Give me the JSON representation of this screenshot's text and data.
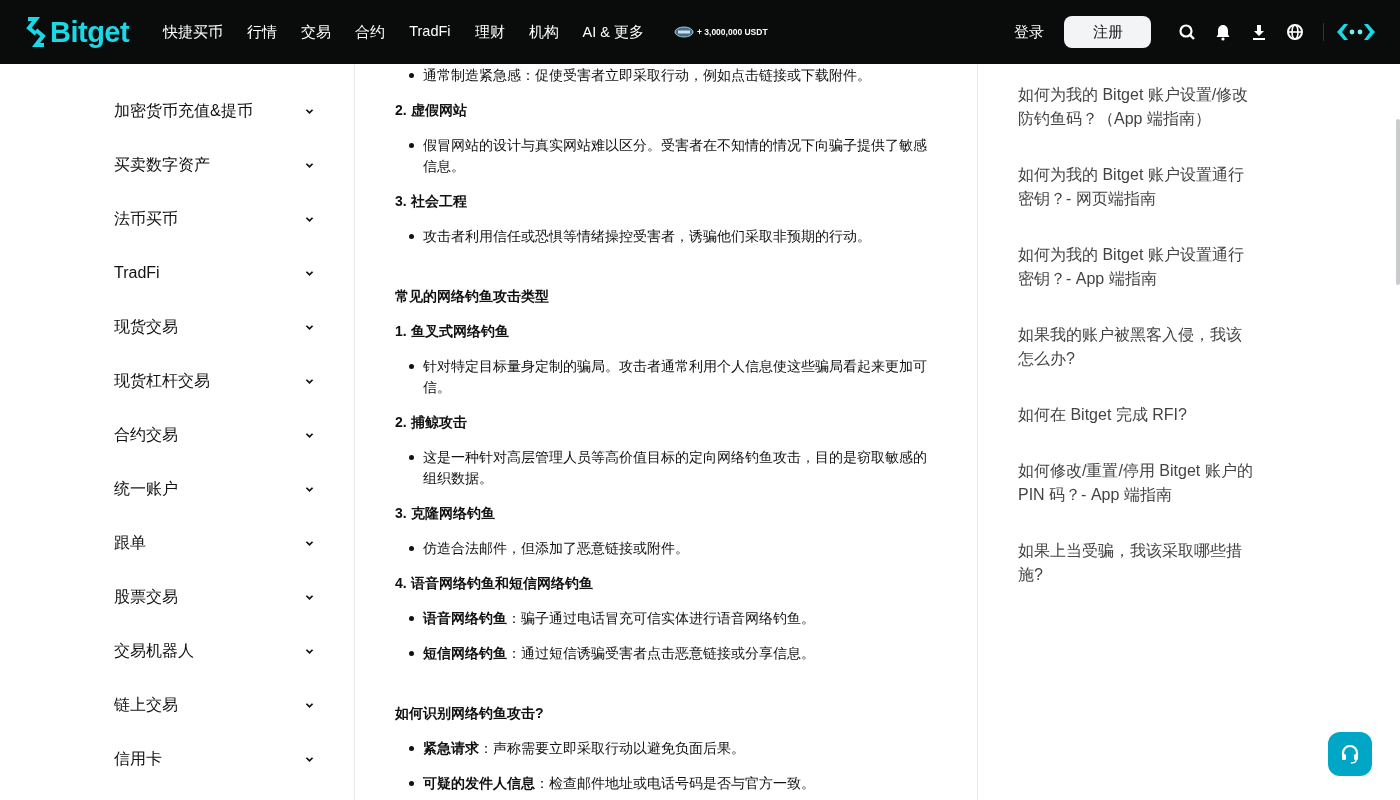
{
  "header": {
    "logo": "Bitget",
    "nav": [
      "快捷买币",
      "行情",
      "交易",
      "合约",
      "TradFi",
      "理财",
      "机构",
      "AI & 更多"
    ],
    "promo": "+ 3,000,000 USDT",
    "login": "登录",
    "signup": "注册"
  },
  "sidebar": {
    "items": [
      {
        "label": "加密货币充值&提币",
        "expanded": false
      },
      {
        "label": "买卖数字资产",
        "expanded": false
      },
      {
        "label": "法币买币",
        "expanded": false
      },
      {
        "label": "TradFi",
        "expanded": false
      },
      {
        "label": "现货交易",
        "expanded": false
      },
      {
        "label": "现货杠杆交易",
        "expanded": false
      },
      {
        "label": "合约交易",
        "expanded": false
      },
      {
        "label": "统一账户",
        "expanded": false
      },
      {
        "label": "跟单",
        "expanded": false
      },
      {
        "label": "股票交易",
        "expanded": false
      },
      {
        "label": "交易机器人",
        "expanded": false
      },
      {
        "label": "链上交易",
        "expanded": false
      },
      {
        "label": "信用卡",
        "expanded": false
      }
    ]
  },
  "article": {
    "blocks": [
      {
        "kind": "bullet",
        "text": "通常制造紧急感：促使受害者立即采取行动，例如点击链接或下载附件。"
      },
      {
        "kind": "subheading",
        "text": "2. 虚假网站"
      },
      {
        "kind": "bullet",
        "text": "假冒网站的设计与真实网站难以区分。受害者在不知情的情况下向骗子提供了敏感信息。"
      },
      {
        "kind": "subheading",
        "text": "3. 社会工程"
      },
      {
        "kind": "bullet",
        "text": "攻击者利用信任或恐惧等情绪操控受害者，诱骗他们采取非预期的行动。"
      },
      {
        "kind": "heading",
        "text": "常见的网络钓鱼攻击类型"
      },
      {
        "kind": "subheading",
        "text": "1. 鱼叉式网络钓鱼"
      },
      {
        "kind": "bullet",
        "text": "针对特定目标量身定制的骗局。攻击者通常利用个人信息使这些骗局看起来更加可信。"
      },
      {
        "kind": "subheading",
        "text": "2. 捕鲸攻击"
      },
      {
        "kind": "bullet",
        "text": "这是一种针对高层管理人员等高价值目标的定向网络钓鱼攻击，目的是窃取敏感的组织数据。"
      },
      {
        "kind": "subheading",
        "text": "3. 克隆网络钓鱼"
      },
      {
        "kind": "bullet",
        "text": "仿造合法邮件，但添加了恶意链接或附件。"
      },
      {
        "kind": "subheading",
        "text": "4. 语音网络钓鱼和短信网络钓鱼"
      },
      {
        "kind": "bullet",
        "text": "**语音网络钓鱼**：骗子通过电话冒充可信实体进行语音网络钓鱼。"
      },
      {
        "kind": "bullet",
        "text": "**短信网络钓鱼**：通过短信诱骗受害者点击恶意链接或分享信息。"
      },
      {
        "kind": "heading",
        "text": "如何识别网络钓鱼攻击?"
      },
      {
        "kind": "bullet",
        "text": "**紧急请求**：声称需要立即采取行动以避免负面后果。"
      },
      {
        "kind": "bullet",
        "text": "**可疑的发件人信息**：检查邮件地址或电话号码是否与官方一致。"
      }
    ]
  },
  "related": [
    "如何为我的 Bitget 账户设置/修改防钓鱼码？（App 端指南）",
    "如何为我的 Bitget 账户设置通行密钥？- 网页端指南",
    "如何为我的 Bitget 账户设置通行密钥？- App 端指南",
    "如果我的账户被黑客入侵，我该怎么办?",
    "如何在 Bitget 完成 RFI?",
    "如何修改/重置/停用 Bitget 账户的 PIN 码？- App 端指南",
    "如果上当受骗，我该采取哪些措施?"
  ]
}
